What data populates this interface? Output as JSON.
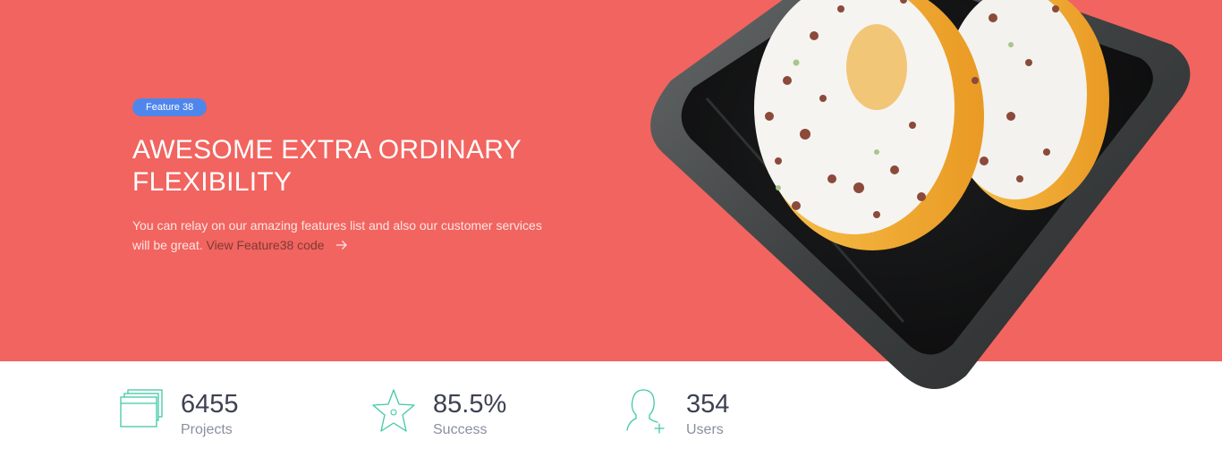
{
  "hero": {
    "badge": "Feature 38",
    "title_line1": "AWESOME EXTRA ORDINARY",
    "title_line2": "FLEXIBILITY",
    "description": "You can relay on our amazing features list and also our customer services will be great.",
    "link_label": "View Feature38 code",
    "background_color": "#f2645f",
    "badge_color": "#4f86ec"
  },
  "stats": [
    {
      "icon": "stacked-windows-icon",
      "value": "6455",
      "label": "Projects"
    },
    {
      "icon": "star-icon",
      "value": "85.5%",
      "label": "Success"
    },
    {
      "icon": "add-user-icon",
      "value": "354",
      "label": "Users"
    }
  ],
  "accent_color": "#3fcaa5"
}
